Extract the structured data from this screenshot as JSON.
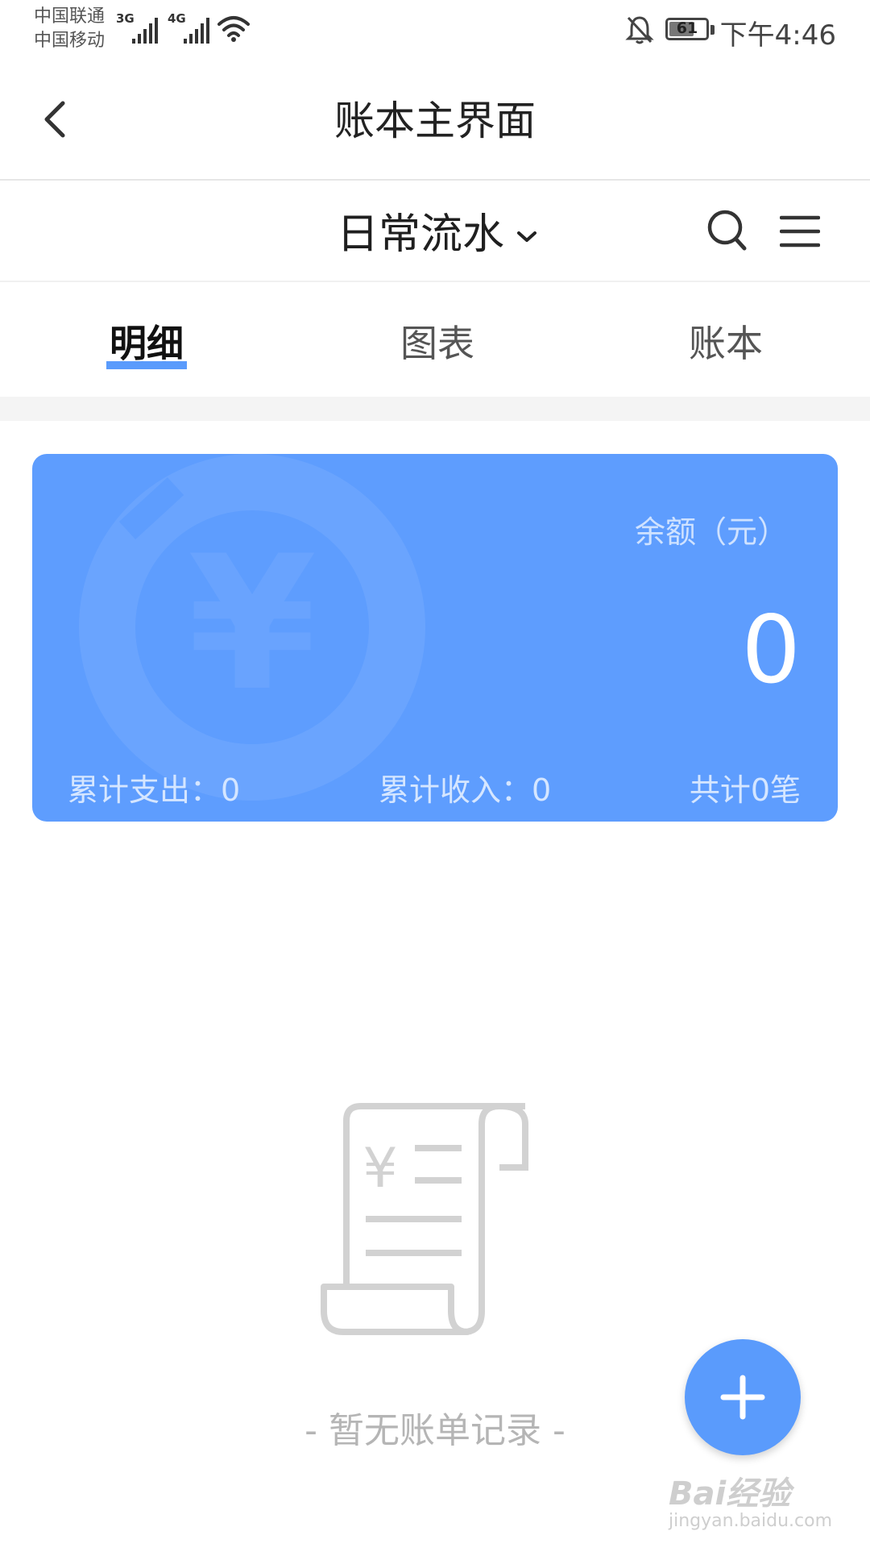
{
  "status_bar": {
    "carrier_1": "中国联通",
    "carrier_2": "中国移动",
    "network_1": "3G",
    "network_2": "4G",
    "battery": "61",
    "time": "下午4:46",
    "icons": [
      "signal-icon",
      "wifi-icon",
      "bell-off-icon",
      "battery-icon"
    ]
  },
  "header": {
    "back_icon": "chevron-left-icon",
    "title": "账本主界面"
  },
  "book_selector": {
    "current_book": "日常流水",
    "dropdown_icon": "chevron-down-icon",
    "search_icon": "search-icon",
    "menu_icon": "menu-icon"
  },
  "tabs": [
    {
      "label": "明细",
      "active": true
    },
    {
      "label": "图表",
      "active": false
    },
    {
      "label": "账本",
      "active": false
    }
  ],
  "balance_card": {
    "balance_label": "余额（元）",
    "balance_value": "0",
    "total_expense": "累计支出：0",
    "total_income": "累计收入：0",
    "record_count": "共计0笔",
    "background_color": "#5e9dfe"
  },
  "empty_state": {
    "icon": "receipt-icon",
    "message": "- 暂无账单记录 -"
  },
  "fab": {
    "icon": "plus-icon"
  },
  "watermark": {
    "brand": "Bai经验",
    "site": "jingyan.baidu.com"
  },
  "colors": {
    "accent": "#5a9bfc",
    "card": "#5e9dfe",
    "muted_text": "#b5b5b5"
  }
}
